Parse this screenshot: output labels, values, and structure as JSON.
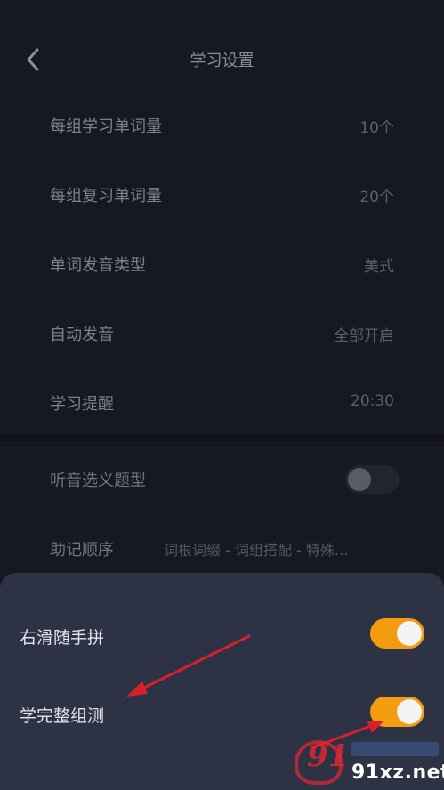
{
  "header": {
    "title": "学习设置"
  },
  "settings": [
    {
      "label": "每组学习单词量",
      "value": "10个"
    },
    {
      "label": "每组复习单词量",
      "value": "20个"
    },
    {
      "label": "单词发音类型",
      "value": "美式"
    },
    {
      "label": "自动发音",
      "value": "全部开启"
    },
    {
      "label": "学习提醒",
      "value": "20:30"
    }
  ],
  "settings2": {
    "listening": {
      "label": "听音选义题型",
      "enabled": false
    },
    "mnemonic": {
      "label": "助记顺序",
      "value": "词根词缀 - 词组搭配 - 特殊…"
    }
  },
  "sheet": {
    "items": [
      {
        "label": "右滑随手拼",
        "enabled": true
      },
      {
        "label": "学完整组测",
        "enabled": true
      }
    ]
  },
  "watermark": {
    "domain": "91xz.net"
  },
  "colors": {
    "accent": "#f39c0f",
    "background": "#15171f",
    "sheet": "#2e3245",
    "annotation_arrow": "#d8202a"
  }
}
